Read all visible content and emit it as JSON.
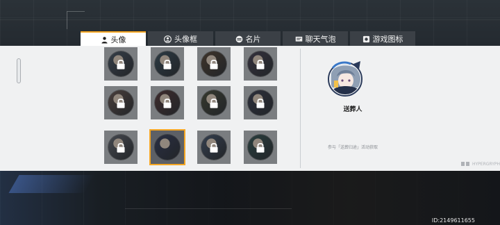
{
  "tabs": [
    {
      "label": "头像",
      "icon": "user-icon",
      "active": true
    },
    {
      "label": "头像框",
      "icon": "user-frame-icon",
      "active": false
    },
    {
      "label": "名片",
      "icon": "card-icon",
      "active": false
    },
    {
      "label": "聊天气泡",
      "icon": "chat-bubble-icon",
      "active": false
    },
    {
      "label": "游戏图标",
      "icon": "game-icon",
      "active": false
    }
  ],
  "grid": {
    "items": [
      {
        "locked": true,
        "selected": false,
        "tone": "#3d4a58"
      },
      {
        "locked": true,
        "selected": false,
        "tone": "#2e4450"
      },
      {
        "locked": true,
        "selected": false,
        "tone": "#4a3a2a"
      },
      {
        "locked": true,
        "selected": false,
        "tone": "#3a3646"
      },
      {
        "locked": true,
        "selected": false,
        "tone": "#5a4a44"
      },
      {
        "locked": true,
        "selected": false,
        "tone": "#4a2e2e"
      },
      {
        "locked": true,
        "selected": false,
        "tone": "#3e4230"
      },
      {
        "locked": true,
        "selected": false,
        "tone": "#2f3344"
      },
      {
        "locked": true,
        "selected": false,
        "tone": "#555a62"
      },
      {
        "locked": false,
        "selected": true,
        "tone": "#2a3250"
      },
      {
        "locked": true,
        "selected": false,
        "tone": "#3a4a60"
      },
      {
        "locked": true,
        "selected": false,
        "tone": "#2a4a48"
      }
    ]
  },
  "detail": {
    "name": "送葬人",
    "source": "参与「送葬归途」活动获取"
  },
  "footer": {
    "logo_text": "HYPERGRYPH",
    "uid": "ID:2149611655"
  },
  "colors": {
    "accent": "#f5a623",
    "tab_inactive": "#3b4046",
    "panel": "#f0f1f2"
  }
}
